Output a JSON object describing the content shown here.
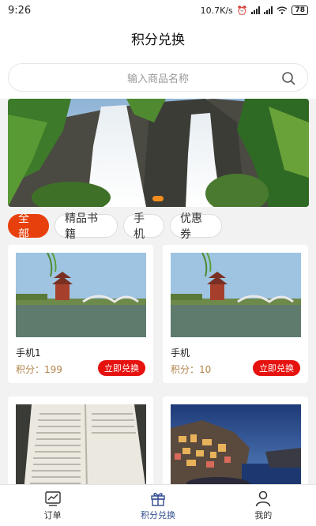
{
  "status": {
    "time": "9:26",
    "network": "10.7K/s",
    "battery": "78"
  },
  "header": {
    "title": "积分兑换"
  },
  "search": {
    "placeholder": "输入商品名称"
  },
  "tabs": [
    {
      "label": "全部",
      "active": true
    },
    {
      "label": "精品书籍",
      "active": false
    },
    {
      "label": "手机",
      "active": false
    },
    {
      "label": "优惠券",
      "active": false
    }
  ],
  "products": [
    {
      "name": "手机1",
      "points": "积分：199",
      "button": "立即兑换"
    },
    {
      "name": "手机",
      "points": "积分：10",
      "button": "立即兑换"
    }
  ],
  "nav": {
    "orders": "订单",
    "exchange": "积分兑换",
    "mine": "我的"
  },
  "colors": {
    "accent": "#e8400c",
    "button": "#e5120f",
    "nav_active": "#2f4a8e",
    "points": "#b0844a"
  }
}
